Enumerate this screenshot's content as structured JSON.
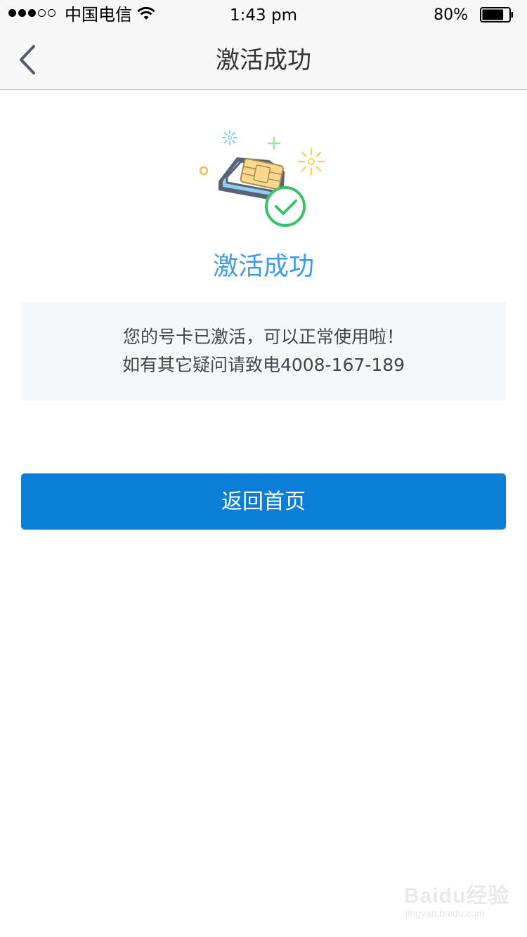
{
  "status_bar": {
    "signal_bars": 5,
    "signal_filled": 3,
    "carrier": "中国电信",
    "time": "1:43 pm",
    "battery_percent": "80%",
    "battery_level": 0.8
  },
  "nav": {
    "title": "激活成功",
    "back_icon": "chevron-left-icon"
  },
  "main": {
    "illustration_icon": "sim-card-success-icon",
    "success_title": "激活成功",
    "message_line1": "您的号卡已激活，可以正常使用啦！",
    "message_line2": "如有其它疑问请致电4008-167-189"
  },
  "actions": {
    "home_button_label": "返回首页"
  },
  "watermark": {
    "logo": "Baidu经验",
    "url": "jingyan.baidu.com"
  },
  "colors": {
    "accent": "#0b7fd7",
    "title_blue": "#3d9be9",
    "success_green": "#3cc06a",
    "message_bg": "#f4f8fb"
  }
}
